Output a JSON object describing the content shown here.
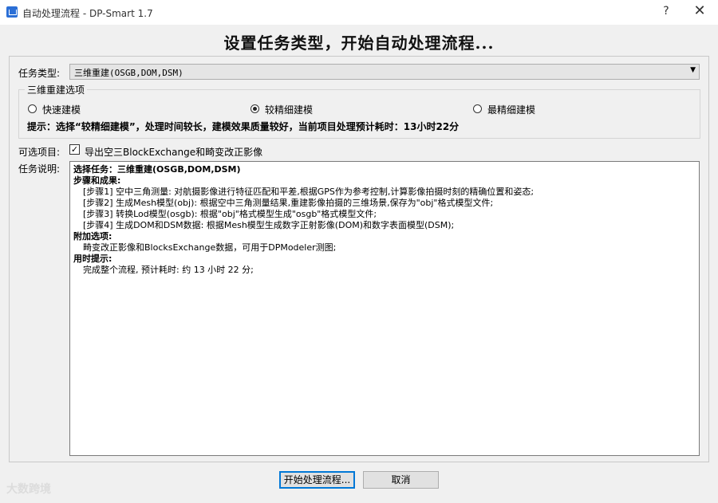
{
  "window": {
    "title": "自动处理流程 - DP-Smart 1.7",
    "help": "?",
    "close": "✕"
  },
  "heading": "设置任务类型，开始自动处理流程...",
  "task_type": {
    "label": "任务类型:",
    "value": "三维重建(OSGB,DOM,DSM)"
  },
  "options_group": {
    "title": "三维重建选项",
    "radios": [
      {
        "label": "快速建模",
        "checked": false
      },
      {
        "label": "较精细建模",
        "checked": true
      },
      {
        "label": "最精细建模",
        "checked": false
      }
    ],
    "hint": "提示：选择“较精细建模”，处理时间较长，建模效果质量较好，当前项目处理预计耗时：13小时22分"
  },
  "optional": {
    "label": "可选项目:",
    "checkbox_label": "导出空三BlockExchange和畸变改正影像",
    "checked": true,
    "check_glyph": "✓"
  },
  "description": {
    "label": "任务说明:",
    "lines": [
      {
        "text": "选择任务：三维重建(OSGB,DOM,DSM)",
        "style": "b"
      },
      {
        "text": "步骤和成果:",
        "style": "b"
      },
      {
        "text": "[步骤1] 空中三角测量: 对航摄影像进行特征匹配和平差,根据GPS作为参考控制,计算影像拍摄时刻的精确位置和姿态;",
        "style": "ind"
      },
      {
        "text": "[步骤2] 生成Mesh模型(obj): 根据空中三角测量结果,重建影像拍摄的三维场景,保存为\"obj\"格式模型文件;",
        "style": "ind"
      },
      {
        "text": "[步骤3] 转换Lod模型(osgb): 根据\"obj\"格式模型生成\"osgb\"格式模型文件;",
        "style": "ind"
      },
      {
        "text": "[步骤4] 生成DOM和DSM数据: 根据Mesh模型生成数字正射影像(DOM)和数字表面模型(DSM);",
        "style": "ind"
      },
      {
        "text": "附加选项:",
        "style": "b"
      },
      {
        "text": "畸变改正影像和BlocksExchange数据，可用于DPModeler测图;",
        "style": "ind"
      },
      {
        "text": "用时提示:",
        "style": "b"
      },
      {
        "text": "完成整个流程, 预计耗时: 约 13 小时 22 分;",
        "style": "ind"
      }
    ]
  },
  "buttons": {
    "start": "开始处理流程...",
    "cancel": "取消"
  },
  "watermark": "大数跨境"
}
